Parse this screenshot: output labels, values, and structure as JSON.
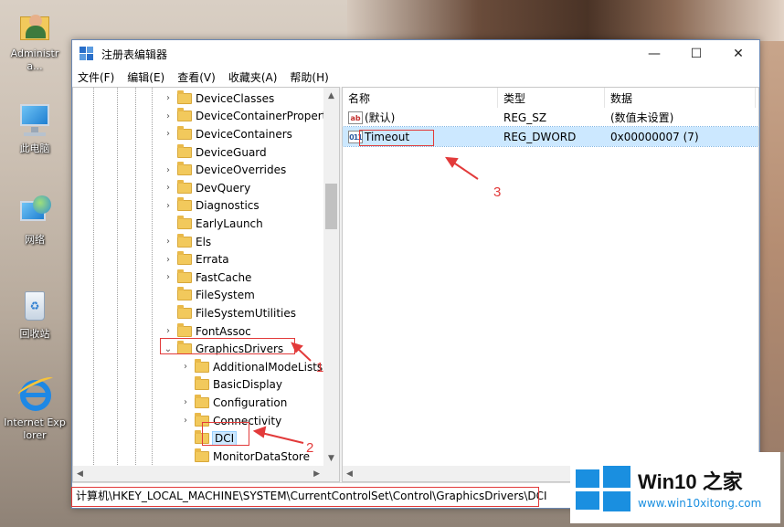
{
  "desktop": {
    "icons": [
      {
        "label": "Administra...",
        "icon": "user-folder-icon"
      },
      {
        "label": "此电脑",
        "icon": "computer-icon"
      },
      {
        "label": "网络",
        "icon": "network-icon"
      },
      {
        "label": "回收站",
        "icon": "recycle-bin-icon"
      },
      {
        "label": "Internet Explorer",
        "icon": "internet-explorer-icon"
      }
    ]
  },
  "window": {
    "title": "注册表编辑器",
    "controls": {
      "minimize": "—",
      "maximize": "☐",
      "close": "✕"
    },
    "menu": [
      "文件(F)",
      "编辑(E)",
      "查看(V)",
      "收藏夹(A)",
      "帮助(H)"
    ]
  },
  "tree": {
    "nodes": [
      {
        "label": "DeviceClasses",
        "expander": "›",
        "level": 0
      },
      {
        "label": "DeviceContainerPropert",
        "expander": "›",
        "level": 0
      },
      {
        "label": "DeviceContainers",
        "expander": "›",
        "level": 0
      },
      {
        "label": "DeviceGuard",
        "expander": "",
        "level": 0
      },
      {
        "label": "DeviceOverrides",
        "expander": "›",
        "level": 0
      },
      {
        "label": "DevQuery",
        "expander": "›",
        "level": 0
      },
      {
        "label": "Diagnostics",
        "expander": "›",
        "level": 0
      },
      {
        "label": "EarlyLaunch",
        "expander": "",
        "level": 0
      },
      {
        "label": "Els",
        "expander": "›",
        "level": 0
      },
      {
        "label": "Errata",
        "expander": "›",
        "level": 0
      },
      {
        "label": "FastCache",
        "expander": "›",
        "level": 0
      },
      {
        "label": "FileSystem",
        "expander": "",
        "level": 0
      },
      {
        "label": "FileSystemUtilities",
        "expander": "",
        "level": 0
      },
      {
        "label": "FontAssoc",
        "expander": "›",
        "level": 0
      },
      {
        "label": "GraphicsDrivers",
        "expander": "⌄",
        "level": 0
      },
      {
        "label": "AdditionalModeLists",
        "expander": "›",
        "level": 1
      },
      {
        "label": "BasicDisplay",
        "expander": "",
        "level": 1
      },
      {
        "label": "Configuration",
        "expander": "›",
        "level": 1
      },
      {
        "label": "Connectivity",
        "expander": "›",
        "level": 1
      },
      {
        "label": "DCI",
        "expander": "",
        "level": 1,
        "selected": true
      },
      {
        "label": "MonitorDataStore",
        "expander": "",
        "level": 1
      }
    ]
  },
  "list": {
    "columns": [
      "名称",
      "类型",
      "数据"
    ],
    "rows": [
      {
        "name": "(默认)",
        "type": "REG_SZ",
        "data": "(数值未设置)",
        "icon": "ab"
      },
      {
        "name": "Timeout",
        "type": "REG_DWORD",
        "data": "0x00000007 (7)",
        "icon": "011",
        "selected": true
      }
    ]
  },
  "statusbar": {
    "path": "计算机\\HKEY_LOCAL_MACHINE\\SYSTEM\\CurrentControlSet\\Control\\GraphicsDrivers\\DCI"
  },
  "annotations": {
    "one": "1",
    "two": "2",
    "three": "3"
  },
  "watermark": {
    "title": "Win10 之家",
    "url": "www.win10xitong.com"
  },
  "colors": {
    "annotation": "#e23a3a",
    "selection": "#cce8ff",
    "accent": "#1a8fe0"
  }
}
